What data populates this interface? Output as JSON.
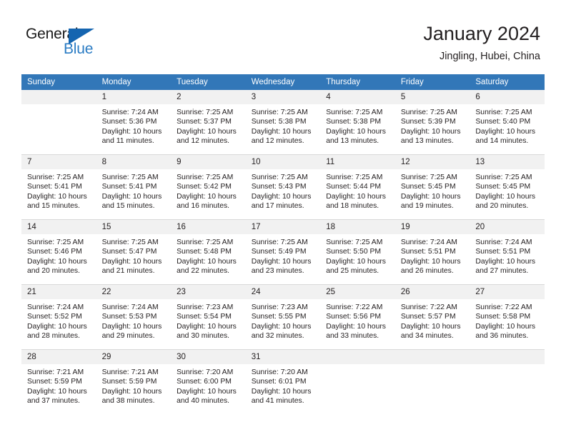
{
  "brand": {
    "name_top": "General",
    "name_bottom": "Blue",
    "accent_color": "#2b7cc4",
    "triangle_color": "#1565b0"
  },
  "header": {
    "title": "January 2024",
    "subtitle": "Jingling, Hubei, China"
  },
  "theme": {
    "header_row_bg": "#3277b8",
    "daynum_bg": "#f1f1f1",
    "text_color": "#231f20",
    "grid_line": "#d9d9d9"
  },
  "weekday_headers": [
    "Sunday",
    "Monday",
    "Tuesday",
    "Wednesday",
    "Thursday",
    "Friday",
    "Saturday"
  ],
  "weeks": [
    [
      {
        "day": "",
        "lines": []
      },
      {
        "day": "1",
        "lines": [
          "Sunrise: 7:24 AM",
          "Sunset: 5:36 PM",
          "Daylight: 10 hours",
          "and 11 minutes."
        ]
      },
      {
        "day": "2",
        "lines": [
          "Sunrise: 7:25 AM",
          "Sunset: 5:37 PM",
          "Daylight: 10 hours",
          "and 12 minutes."
        ]
      },
      {
        "day": "3",
        "lines": [
          "Sunrise: 7:25 AM",
          "Sunset: 5:38 PM",
          "Daylight: 10 hours",
          "and 12 minutes."
        ]
      },
      {
        "day": "4",
        "lines": [
          "Sunrise: 7:25 AM",
          "Sunset: 5:38 PM",
          "Daylight: 10 hours",
          "and 13 minutes."
        ]
      },
      {
        "day": "5",
        "lines": [
          "Sunrise: 7:25 AM",
          "Sunset: 5:39 PM",
          "Daylight: 10 hours",
          "and 13 minutes."
        ]
      },
      {
        "day": "6",
        "lines": [
          "Sunrise: 7:25 AM",
          "Sunset: 5:40 PM",
          "Daylight: 10 hours",
          "and 14 minutes."
        ]
      }
    ],
    [
      {
        "day": "7",
        "lines": [
          "Sunrise: 7:25 AM",
          "Sunset: 5:41 PM",
          "Daylight: 10 hours",
          "and 15 minutes."
        ]
      },
      {
        "day": "8",
        "lines": [
          "Sunrise: 7:25 AM",
          "Sunset: 5:41 PM",
          "Daylight: 10 hours",
          "and 15 minutes."
        ]
      },
      {
        "day": "9",
        "lines": [
          "Sunrise: 7:25 AM",
          "Sunset: 5:42 PM",
          "Daylight: 10 hours",
          "and 16 minutes."
        ]
      },
      {
        "day": "10",
        "lines": [
          "Sunrise: 7:25 AM",
          "Sunset: 5:43 PM",
          "Daylight: 10 hours",
          "and 17 minutes."
        ]
      },
      {
        "day": "11",
        "lines": [
          "Sunrise: 7:25 AM",
          "Sunset: 5:44 PM",
          "Daylight: 10 hours",
          "and 18 minutes."
        ]
      },
      {
        "day": "12",
        "lines": [
          "Sunrise: 7:25 AM",
          "Sunset: 5:45 PM",
          "Daylight: 10 hours",
          "and 19 minutes."
        ]
      },
      {
        "day": "13",
        "lines": [
          "Sunrise: 7:25 AM",
          "Sunset: 5:45 PM",
          "Daylight: 10 hours",
          "and 20 minutes."
        ]
      }
    ],
    [
      {
        "day": "14",
        "lines": [
          "Sunrise: 7:25 AM",
          "Sunset: 5:46 PM",
          "Daylight: 10 hours",
          "and 20 minutes."
        ]
      },
      {
        "day": "15",
        "lines": [
          "Sunrise: 7:25 AM",
          "Sunset: 5:47 PM",
          "Daylight: 10 hours",
          "and 21 minutes."
        ]
      },
      {
        "day": "16",
        "lines": [
          "Sunrise: 7:25 AM",
          "Sunset: 5:48 PM",
          "Daylight: 10 hours",
          "and 22 minutes."
        ]
      },
      {
        "day": "17",
        "lines": [
          "Sunrise: 7:25 AM",
          "Sunset: 5:49 PM",
          "Daylight: 10 hours",
          "and 23 minutes."
        ]
      },
      {
        "day": "18",
        "lines": [
          "Sunrise: 7:25 AM",
          "Sunset: 5:50 PM",
          "Daylight: 10 hours",
          "and 25 minutes."
        ]
      },
      {
        "day": "19",
        "lines": [
          "Sunrise: 7:24 AM",
          "Sunset: 5:51 PM",
          "Daylight: 10 hours",
          "and 26 minutes."
        ]
      },
      {
        "day": "20",
        "lines": [
          "Sunrise: 7:24 AM",
          "Sunset: 5:51 PM",
          "Daylight: 10 hours",
          "and 27 minutes."
        ]
      }
    ],
    [
      {
        "day": "21",
        "lines": [
          "Sunrise: 7:24 AM",
          "Sunset: 5:52 PM",
          "Daylight: 10 hours",
          "and 28 minutes."
        ]
      },
      {
        "day": "22",
        "lines": [
          "Sunrise: 7:24 AM",
          "Sunset: 5:53 PM",
          "Daylight: 10 hours",
          "and 29 minutes."
        ]
      },
      {
        "day": "23",
        "lines": [
          "Sunrise: 7:23 AM",
          "Sunset: 5:54 PM",
          "Daylight: 10 hours",
          "and 30 minutes."
        ]
      },
      {
        "day": "24",
        "lines": [
          "Sunrise: 7:23 AM",
          "Sunset: 5:55 PM",
          "Daylight: 10 hours",
          "and 32 minutes."
        ]
      },
      {
        "day": "25",
        "lines": [
          "Sunrise: 7:22 AM",
          "Sunset: 5:56 PM",
          "Daylight: 10 hours",
          "and 33 minutes."
        ]
      },
      {
        "day": "26",
        "lines": [
          "Sunrise: 7:22 AM",
          "Sunset: 5:57 PM",
          "Daylight: 10 hours",
          "and 34 minutes."
        ]
      },
      {
        "day": "27",
        "lines": [
          "Sunrise: 7:22 AM",
          "Sunset: 5:58 PM",
          "Daylight: 10 hours",
          "and 36 minutes."
        ]
      }
    ],
    [
      {
        "day": "28",
        "lines": [
          "Sunrise: 7:21 AM",
          "Sunset: 5:59 PM",
          "Daylight: 10 hours",
          "and 37 minutes."
        ]
      },
      {
        "day": "29",
        "lines": [
          "Sunrise: 7:21 AM",
          "Sunset: 5:59 PM",
          "Daylight: 10 hours",
          "and 38 minutes."
        ]
      },
      {
        "day": "30",
        "lines": [
          "Sunrise: 7:20 AM",
          "Sunset: 6:00 PM",
          "Daylight: 10 hours",
          "and 40 minutes."
        ]
      },
      {
        "day": "31",
        "lines": [
          "Sunrise: 7:20 AM",
          "Sunset: 6:01 PM",
          "Daylight: 10 hours",
          "and 41 minutes."
        ]
      },
      {
        "day": "",
        "lines": []
      },
      {
        "day": "",
        "lines": []
      },
      {
        "day": "",
        "lines": []
      }
    ]
  ]
}
